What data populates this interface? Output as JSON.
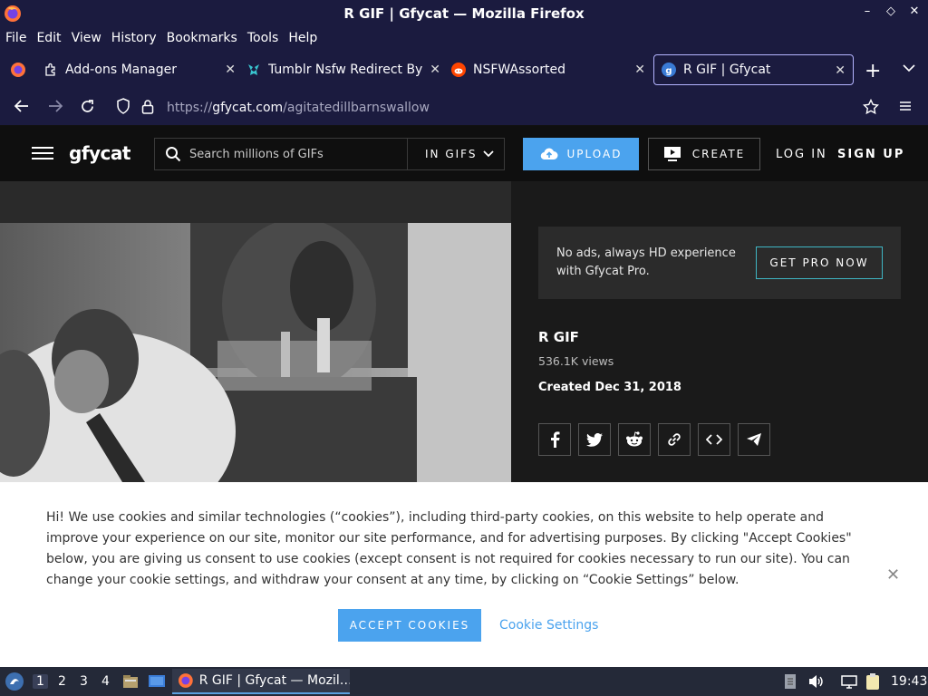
{
  "window": {
    "title": "R GIF | Gfycat — Mozilla Firefox"
  },
  "menu": [
    "File",
    "Edit",
    "View",
    "History",
    "Bookmarks",
    "Tools",
    "Help"
  ],
  "tabs": [
    {
      "label": "Add-ons Manager",
      "icon": "puzzle-icon",
      "active": false
    },
    {
      "label": "Tumblr Nsfw Redirect Byp",
      "icon": "tumblr-extension-icon",
      "active": false
    },
    {
      "label": "NSFWAssorted",
      "icon": "reddit-icon",
      "active": false
    },
    {
      "label": "R GIF | Gfycat",
      "icon": "gfycat-icon",
      "active": true
    }
  ],
  "url": {
    "prefix": "https://",
    "host": "gfycat.com",
    "path": "/agitatedillbarnswallow"
  },
  "site": {
    "logo": "gfycat",
    "search_placeholder": "Search millions of GIFs",
    "search_scope": "IN GIFS",
    "upload_label": "UPLOAD",
    "create_label": "CREATE",
    "login_label": "LOG IN",
    "signup_label": "SIGN UP"
  },
  "promo": {
    "text": "No ads, always HD experience with Gfycat Pro.",
    "button": "GET PRO NOW"
  },
  "gif": {
    "title": "R GIF",
    "views": "536.1K views",
    "created": "Created Dec 31, 2018"
  },
  "share": [
    "facebook-icon",
    "twitter-icon",
    "reddit-icon",
    "link-icon",
    "embed-code-icon",
    "send-icon"
  ],
  "cookie": {
    "text": "Hi! We use cookies and similar technologies (“cookies”), including third-party cookies, on this website to help operate and improve your experience on our site, monitor our site performance, and for advertising purposes. By clicking \"Accept Cookies\" below, you are giving us consent to use cookies (except consent is not required for cookies necessary to run our site). You can change your cookie settings, and withdraw your consent at any time, by clicking on “Cookie Settings” below.",
    "accept": "ACCEPT COOKIES",
    "settings": "Cookie Settings"
  },
  "taskbar": {
    "workspaces": [
      "1",
      "2",
      "3",
      "4"
    ],
    "window_label": "R GIF | Gfycat — Mozil…",
    "clock": "19:43"
  },
  "colors": {
    "accent": "#4ba3ee",
    "browser_chrome": "#1b1b3f",
    "pro_border": "#3fb6c4"
  }
}
